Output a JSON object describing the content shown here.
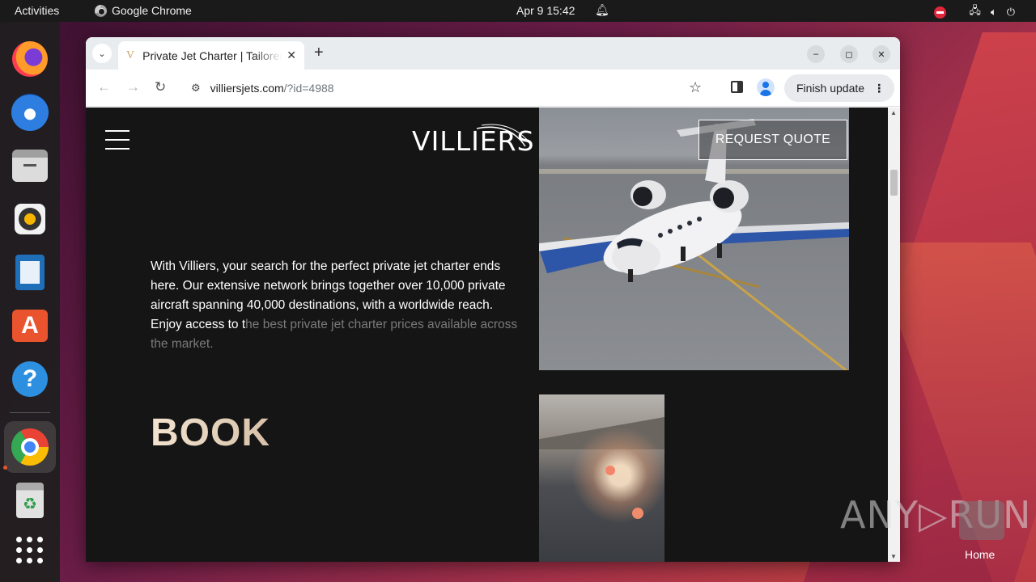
{
  "topbar": {
    "activities": "Activities",
    "app_name": "Google Chrome",
    "clock": "Apr 9  15:42"
  },
  "browser": {
    "tab_favicon": "V",
    "tab_title": "Private Jet Charter | Tailored",
    "tab_close": "✕",
    "new_tab": "+",
    "minimize": "–",
    "maximize": "◻",
    "close": "✕",
    "url_host": "villiersjets.com",
    "url_path": "/?id=4988",
    "finish_update": "Finish update"
  },
  "page": {
    "logo": "VILLIERS",
    "request_quote": "REQUEST QUOTE",
    "intro_visible": "With Villiers, your search for the perfect private jet charter ends here. Our extensive network brings together over 10,000 private aircraft spanning 40,000 destinations, with a worldwide reach. Enjoy access to t",
    "intro_faded": "he best private jet charter prices available across the market.",
    "book_heading": "BOOK"
  },
  "desktop": {
    "watermark": "ANY▷RUN",
    "home_label": "Home"
  },
  "icons": {
    "dock": [
      "firefox-icon",
      "thunderbird-icon",
      "files-icon",
      "rhythmbox-icon",
      "writer-icon",
      "app-center-icon",
      "help-icon",
      "chrome-icon",
      "trash-icon",
      "show-apps-icon"
    ]
  }
}
